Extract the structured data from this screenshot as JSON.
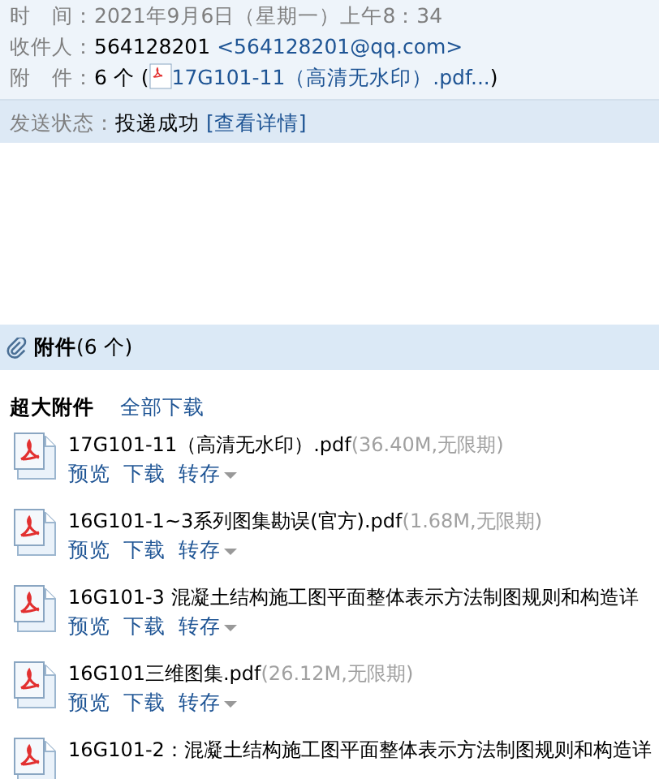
{
  "header": {
    "fields": [
      {
        "label": "时　间：",
        "kind": "plain",
        "value": "2021年9月6日（星期一）上午8：34"
      },
      {
        "label": "收件人：",
        "kind": "recipient",
        "value": "564128201",
        "extra": "<564128201@qq.com>"
      },
      {
        "label": "附　件：",
        "kind": "attachment",
        "value": "6 个 (",
        "link": "17G101-11（高清无水印）.pdf...",
        "tail": ")"
      }
    ],
    "status": {
      "label": "发送状态：",
      "value": "投递成功",
      "link": "[查看详情]"
    }
  },
  "attachments": {
    "title": "附件",
    "count": "(6 个)",
    "section": "超大附件",
    "download_all": "全部下载",
    "items": [
      {
        "name": "17G101-11（高清无水印）.pdf",
        "meta": "(36.40M,无限期)",
        "actions": [
          "预览",
          "下载",
          "转存"
        ]
      },
      {
        "name": "16G101-1~3系列图集勘误(官方).pdf",
        "meta": "(1.68M,无限期)",
        "actions": [
          "预览",
          "下载",
          "转存"
        ]
      },
      {
        "name": "16G101-3 混凝土结构施工图平面整体表示方法制图规则和构造详",
        "actions": [
          "预览",
          "下载",
          "转存"
        ]
      },
      {
        "name": "16G101三维图集.pdf",
        "meta": "(26.12M,无限期)",
        "actions": [
          "预览",
          "下载",
          "转存"
        ]
      },
      {
        "name": "16G101-2：混凝土结构施工图平面整体表示方法制图规则和构造详"
      }
    ]
  }
}
